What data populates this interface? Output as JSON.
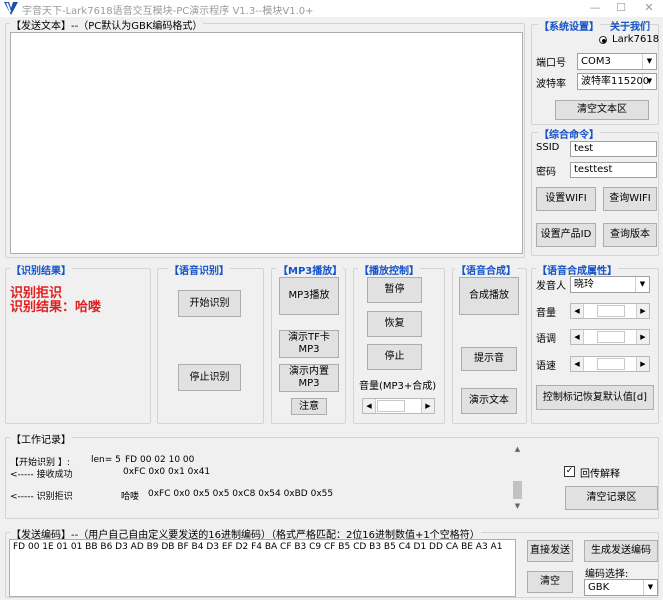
{
  "window": {
    "title": "宇音天下-Lark7618语音交互模块-PC演示程序 V1.3--模块V1.0+",
    "minimize": "—",
    "maximize": "☐",
    "close": "✕"
  },
  "send_text": {
    "title": "【发送文本】",
    "subtitle": "--（PC默认为GBK编码格式）",
    "value": ""
  },
  "system": {
    "title": "【系统设置】",
    "about": "关于我们",
    "radio_label": "Lark7618",
    "port_label": "端口号",
    "port_value": "COM3",
    "baud_label": "波特率",
    "baud_value": "波特率115200",
    "clear_text_button": "清空文本区"
  },
  "commands": {
    "title": "【综合命令】",
    "ssid_label": "SSID",
    "ssid_value": "test",
    "password_label": "密码",
    "password_value": "testtest",
    "set_wifi": "设置WIFI",
    "query_wifi": "查询WIFI",
    "set_product_id": "设置产品ID",
    "query_version": "查询版本"
  },
  "recognition_result": {
    "title": "【识别结果】",
    "line1": "识别拒识",
    "line2": "识别结果：哈喽"
  },
  "recognition": {
    "title": "【语音识别】",
    "start": "开始识别",
    "stop": "停止识别"
  },
  "mp3": {
    "title": "【MP3播放】",
    "play": "MP3播放",
    "play_tf": "演示TF卡\nMP3",
    "play_builtin": "演示内置\nMP3",
    "note": "注意"
  },
  "playback": {
    "title": "【播放控制】",
    "pause": "暂停",
    "resume": "恢复",
    "stop": "停止",
    "volume_label": "音量(MP3+合成)"
  },
  "synthesis": {
    "title": "【语音合成】",
    "play": "合成播放",
    "prompt": "提示音",
    "demo": "演示文本"
  },
  "synthesis_props": {
    "title": "【语音合成属性】",
    "speaker_label": "发音人",
    "speaker_value": "晓玲",
    "volume_label": "音量",
    "pitch_label": "语调",
    "speed_label": "语速",
    "restore_button": "控制标记恢复默认值[d]"
  },
  "work_log": {
    "title": "【工作记录】",
    "entries": [
      {
        "prefix": "【开始识别   】:",
        "mid": "len= 5",
        "data": "FD 00 02 10 00"
      },
      {
        "prefix": "<-----   接收成功",
        "mid": "",
        "data": "0xFC 0x0 0x1 0x41"
      },
      {
        "prefix": "<-----   识别拒识",
        "mid": "哈喽",
        "data": "0xFC 0x0 0x5 0x5 0xC8 0x54 0xBD 0x55"
      }
    ],
    "echo_label": "回传解释",
    "echo_checked": "✓",
    "clear_button": "清空记录区"
  },
  "send_code": {
    "title": "【发送编码】",
    "subtitle": "--（用户自己自由定义要发送的16进制编码）（格式严格匹配：2位16进制数值+1个空格符）",
    "value": "FD 00 1E 01 01 BB B6 D3 AD B9 DB BF B4 D3 EF D2 F4 BA CF B3 C9 CF B5 CD B3 B5 C4 D1 DD CA BE A3 A1",
    "send_button": "直接发送",
    "generate_button": "生成发送编码",
    "clear_button": "清空",
    "encoding_label": "编码选择:",
    "encoding_value": "GBK"
  }
}
